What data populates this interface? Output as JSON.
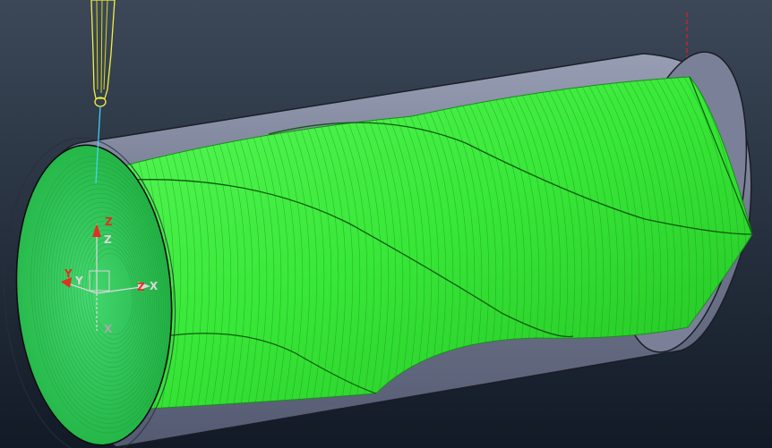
{
  "viewport": {
    "background_top": "#3c4858",
    "background_bottom": "#121a26"
  },
  "stock": {
    "fill": "#8a90a8",
    "edge": "#1a1d26",
    "inner_fill": "#6a7088"
  },
  "toolpath": {
    "color": "#3cf03c",
    "line_color": "#1e8a1e",
    "pattern": "helical"
  },
  "tool": {
    "color": "#f0f040",
    "shank_color": "#d8d820",
    "tip_line_color": "#40d8ff"
  },
  "triad": {
    "axes": [
      {
        "label": "Z",
        "color": "#e03020"
      },
      {
        "label": "Z",
        "color": "#d8d8d8"
      },
      {
        "label": "Y",
        "color": "#e03020"
      },
      {
        "label": "Y",
        "color": "#d8d8d8"
      },
      {
        "label": "Z",
        "color": "#e03020"
      },
      {
        "label": "X",
        "color": "#d8d8d8"
      },
      {
        "label": "X",
        "color": "#a8a8a8"
      }
    ]
  },
  "reference_line_color": "#e02020"
}
